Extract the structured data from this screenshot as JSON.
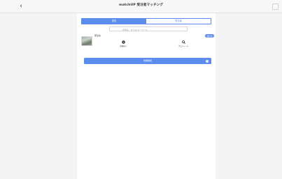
{
  "header": {
    "title": "matchUP 受注者マッチング",
    "back_icon": "chevron-left-icon",
    "close_icon": "window-button-icon"
  },
  "tabs": [
    {
      "label": "送信",
      "active": true
    },
    {
      "label": "受注者",
      "active": false
    }
  ],
  "search": {
    "placeholder": "条件名、または キーワード"
  },
  "candidate": {
    "name": "受注先",
    "send_label": "送信済",
    "actions": [
      {
        "icon": "record-icon",
        "label": "詳細表示"
      },
      {
        "icon": "magnify-icon",
        "label": "プロフィール"
      }
    ]
  },
  "confirm": {
    "label": "依頼確認"
  },
  "colors": {
    "accent": "#5b8def",
    "background": "#f4f4f4",
    "panel": "#ffffff"
  }
}
